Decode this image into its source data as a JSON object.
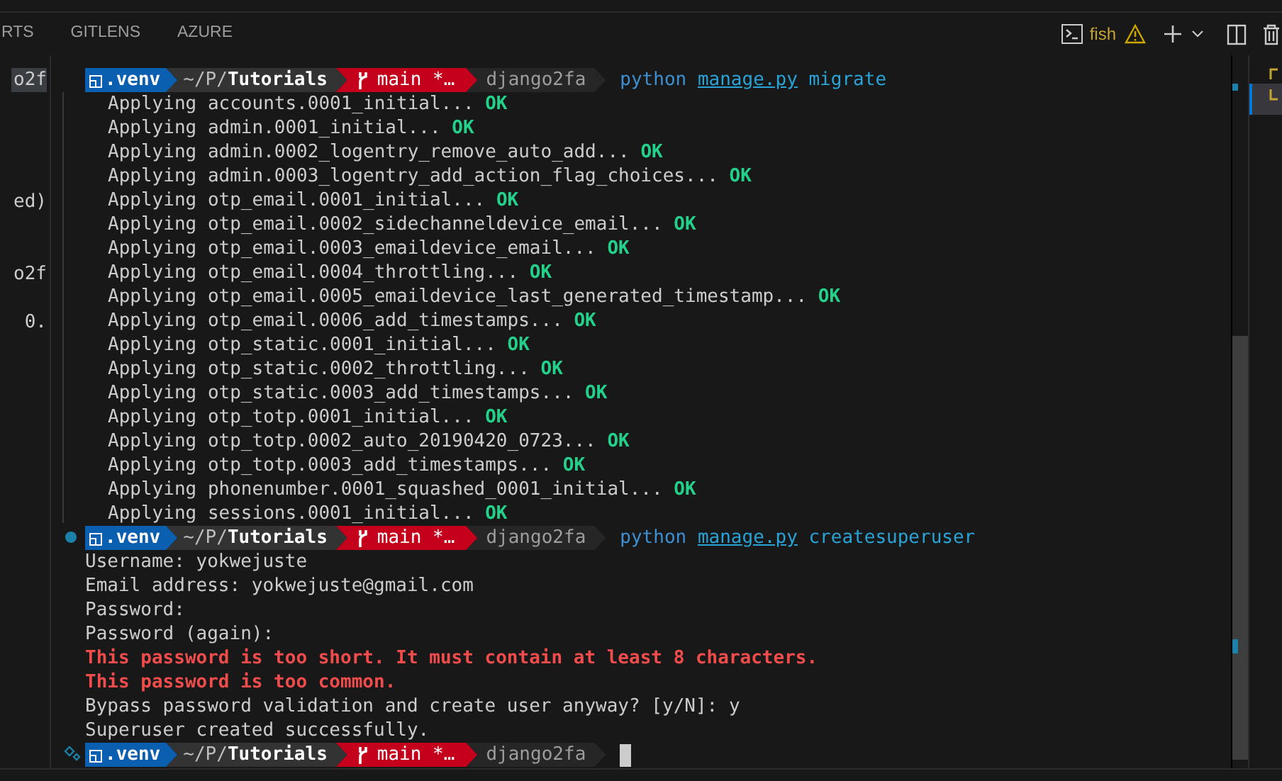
{
  "panel_tabs": [
    {
      "label": "RTS",
      "selected": false
    },
    {
      "label": "GITLENS",
      "selected": false
    },
    {
      "label": "AZURE",
      "selected": false
    }
  ],
  "terminal_toolbar": {
    "shell": "fish"
  },
  "editor_fragments": [
    {
      "text": "o2f",
      "highlighted": true
    },
    {
      "text": "ed)",
      "highlighted": false
    },
    {
      "text": "o2f",
      "highlighted": false
    },
    {
      "text": "0.",
      "highlighted": false
    }
  ],
  "blocks": [
    {
      "kind": "plain",
      "prompt": {
        "venv": ".venv",
        "path_dim": "~/P/",
        "path_bold": "Tutorials",
        "branch": "main *…",
        "project": "django2fa"
      },
      "command": {
        "program": "python",
        "file": "manage.py",
        "args": "migrate"
      },
      "output": [
        {
          "kind": "migration",
          "text": "Applying accounts.0001_initial...",
          "status": "OK"
        },
        {
          "kind": "migration",
          "text": "Applying admin.0001_initial...",
          "status": "OK"
        },
        {
          "kind": "migration",
          "text": "Applying admin.0002_logentry_remove_auto_add...",
          "status": "OK"
        },
        {
          "kind": "migration",
          "text": "Applying admin.0003_logentry_add_action_flag_choices...",
          "status": "OK"
        },
        {
          "kind": "migration",
          "text": "Applying otp_email.0001_initial...",
          "status": "OK"
        },
        {
          "kind": "migration",
          "text": "Applying otp_email.0002_sidechanneldevice_email...",
          "status": "OK"
        },
        {
          "kind": "migration",
          "text": "Applying otp_email.0003_emaildevice_email...",
          "status": "OK"
        },
        {
          "kind": "migration",
          "text": "Applying otp_email.0004_throttling...",
          "status": "OK"
        },
        {
          "kind": "migration",
          "text": "Applying otp_email.0005_emaildevice_last_generated_timestamp...",
          "status": "OK"
        },
        {
          "kind": "migration",
          "text": "Applying otp_email.0006_add_timestamps...",
          "status": "OK"
        },
        {
          "kind": "migration",
          "text": "Applying otp_static.0001_initial...",
          "status": "OK"
        },
        {
          "kind": "migration",
          "text": "Applying otp_static.0002_throttling...",
          "status": "OK"
        },
        {
          "kind": "migration",
          "text": "Applying otp_static.0003_add_timestamps...",
          "status": "OK"
        },
        {
          "kind": "migration",
          "text": "Applying otp_totp.0001_initial...",
          "status": "OK"
        },
        {
          "kind": "migration",
          "text": "Applying otp_totp.0002_auto_20190420_0723...",
          "status": "OK"
        },
        {
          "kind": "migration",
          "text": "Applying otp_totp.0003_add_timestamps...",
          "status": "OK"
        },
        {
          "kind": "migration",
          "text": "Applying phonenumber.0001_squashed_0001_initial...",
          "status": "OK"
        },
        {
          "kind": "migration",
          "text": "Applying sessions.0001_initial...",
          "status": "OK"
        }
      ]
    },
    {
      "kind": "success",
      "prompt": {
        "venv": ".venv",
        "path_dim": "~/P/",
        "path_bold": "Tutorials",
        "branch": "main *…",
        "project": "django2fa"
      },
      "command": {
        "program": "python",
        "file": "manage.py",
        "args": "createsuperuser"
      },
      "output": [
        {
          "kind": "plain",
          "text": "Username: yokwejuste"
        },
        {
          "kind": "plain",
          "text": "Email address: yokwejuste@gmail.com"
        },
        {
          "kind": "plain",
          "text": "Password:"
        },
        {
          "kind": "plain",
          "text": "Password (again):"
        },
        {
          "kind": "error",
          "text": "This password is too short. It must contain at least 8 characters."
        },
        {
          "kind": "error",
          "text": "This password is too common."
        },
        {
          "kind": "plain",
          "text": "Bypass password validation and create user anyway? [y/N]: y"
        },
        {
          "kind": "plain",
          "text": "Superuser created successfully."
        }
      ]
    },
    {
      "kind": "current",
      "prompt": {
        "venv": ".venv",
        "path_dim": "~/P/",
        "path_bold": "Tutorials",
        "branch": "main *…",
        "project": "django2fa"
      },
      "cursor": true
    }
  ]
}
